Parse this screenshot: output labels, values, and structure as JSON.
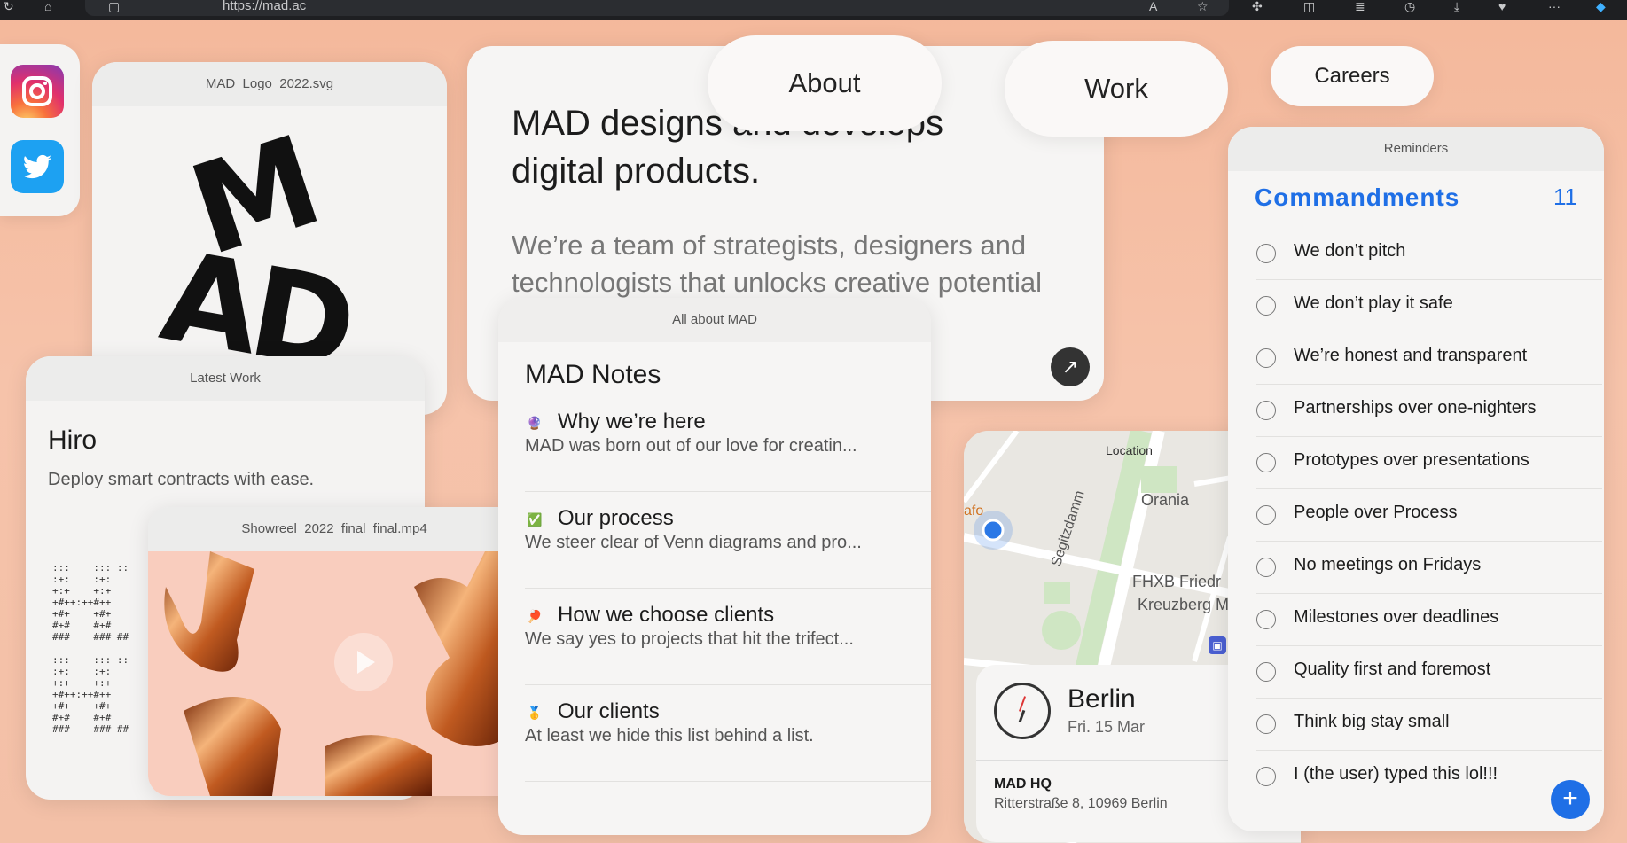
{
  "browser": {
    "url": "https://mad.ac"
  },
  "nav": {
    "about": "About",
    "work": "Work",
    "careers": "Careers"
  },
  "logo_card": {
    "title": "MAD_Logo_2022.svg",
    "logo_top": "M",
    "logo_bottom": "AD"
  },
  "intro_card": {
    "headline": "MAD designs and develops digital products.",
    "body": "We’re a team of strategists, designers and technologists that unlocks creative potential in progressive organizations."
  },
  "latest_work": {
    "title": "Latest Work",
    "project": "Hiro",
    "tagline": "Deploy smart contracts with ease."
  },
  "showreel": {
    "title": "Showreel_2022_final_final.mp4"
  },
  "notes": {
    "window_title": "All about MAD",
    "heading": "MAD Notes",
    "items": [
      {
        "emoji": "🔮",
        "title": "Why we’re here",
        "sub": "MAD was born out of our love for creatin..."
      },
      {
        "emoji": "✅",
        "title": "Our process",
        "sub": "We steer clear of Venn diagrams and pro..."
      },
      {
        "emoji": "🏓",
        "title": "How we choose clients",
        "sub": "We say yes to projects that hit the trifect..."
      },
      {
        "emoji": "🥇",
        "title": "Our clients",
        "sub": "At least we hide this list behind a list."
      }
    ]
  },
  "map": {
    "location_label": "Location",
    "place1": "Orania",
    "place2": "FHXB Friedr",
    "place3": "Kreuzberg M",
    "street": "Segitzdamm",
    "edge": "afo",
    "city": "Berlin",
    "date": "Fri. 15 Mar",
    "hq_name": "MAD HQ",
    "hq_address": "Ritterstraße 8, 10969 Berlin"
  },
  "reminders": {
    "window_title": "Reminders",
    "list_name": "Commandments",
    "count": "11",
    "accent_color": "#1f6fe6",
    "items": [
      "We don’t pitch",
      "We don’t play it safe",
      "We’re honest and transparent",
      "Partnerships over one-nighters",
      "Prototypes over presentations",
      "People over Process",
      "No meetings on Fridays",
      "Milestones over deadlines",
      "Quality first and foremost",
      "Think big stay small",
      "I (the user) typed this lol!!!"
    ]
  },
  "colors": {
    "background": "#f4b89b",
    "card": "#f4f3f2",
    "accent": "#1f6fe6"
  }
}
